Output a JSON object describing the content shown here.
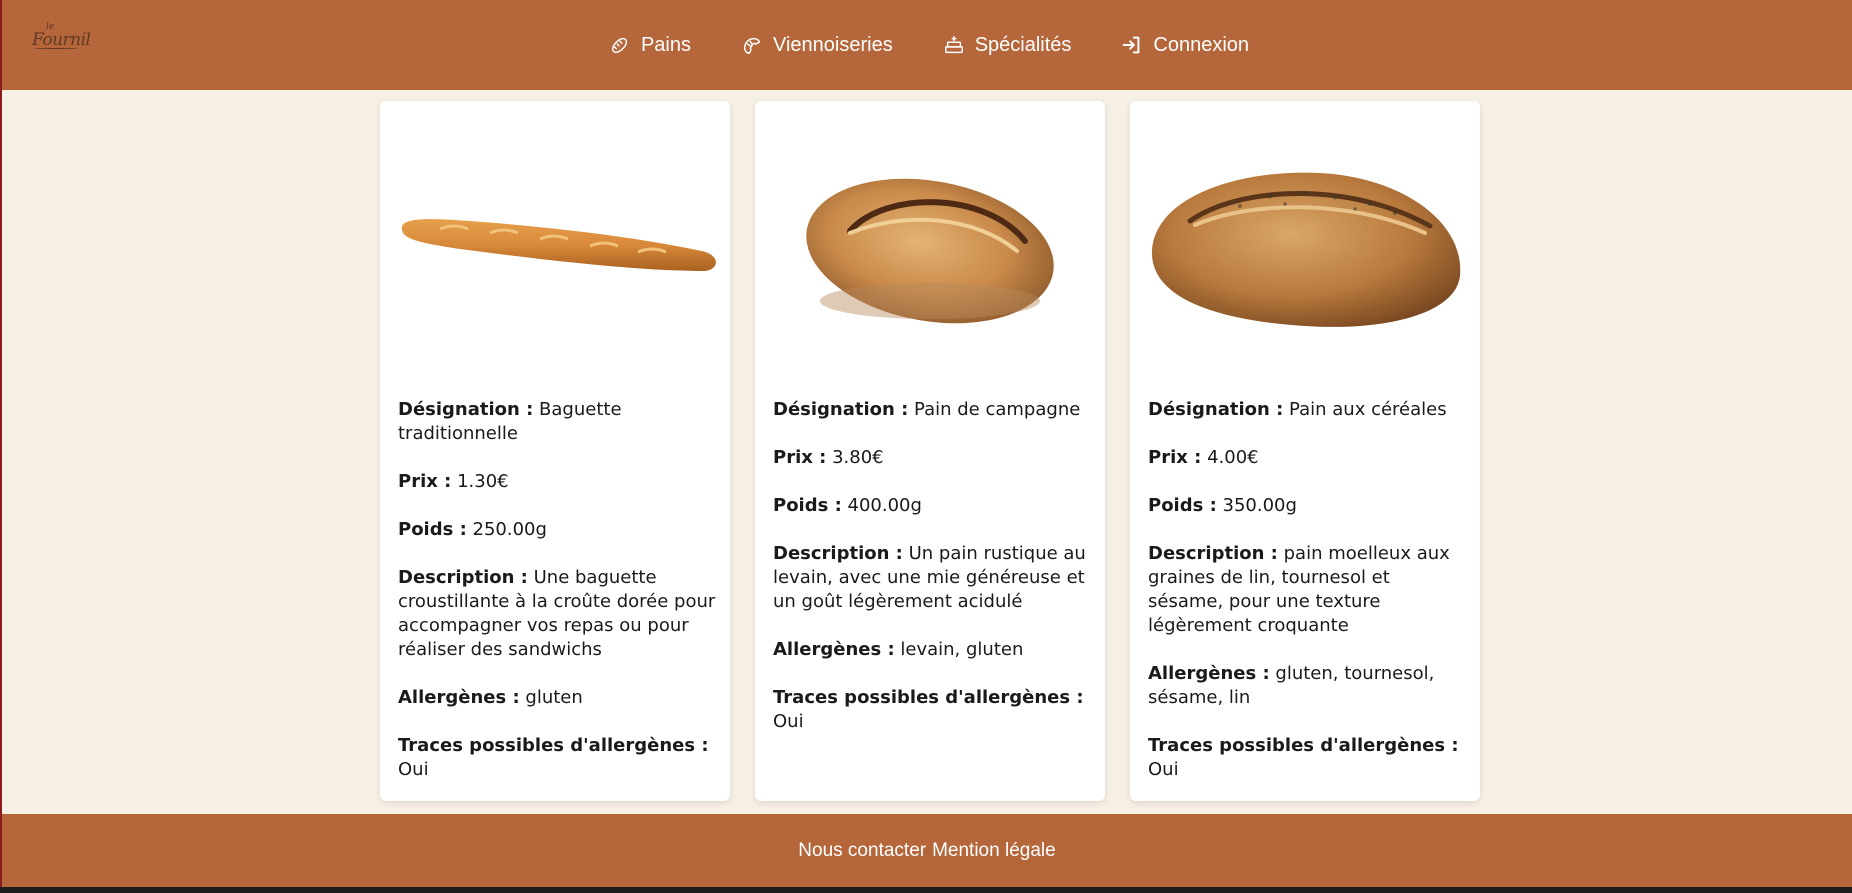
{
  "brand": {
    "logo_alt": "Le Fournil"
  },
  "nav": {
    "items": [
      {
        "label": "Pains",
        "icon": "bread-icon"
      },
      {
        "label": "Viennoiseries",
        "icon": "croissant-icon"
      },
      {
        "label": "Spécialités",
        "icon": "cake-icon"
      },
      {
        "label": "Connexion",
        "icon": "login-icon"
      }
    ]
  },
  "labels": {
    "designation": "Désignation :",
    "prix": "Prix :",
    "poids": "Poids :",
    "description": "Description :",
    "allergenes": "Allergènes :",
    "traces": "Traces possibles d'allergènes :"
  },
  "products": [
    {
      "designation": "Baguette traditionnelle",
      "prix": "1.30€",
      "poids": "250.00g",
      "description": "Une baguette croustillante à la croûte dorée pour accompagner vos repas ou pour réaliser des sandwichs",
      "allergenes": "gluten",
      "traces": "Oui"
    },
    {
      "designation": "Pain de campagne",
      "prix": "3.80€",
      "poids": "400.00g",
      "description": "Un pain rustique au levain, avec une mie généreuse et un goût légèrement acidulé",
      "allergenes": "levain, gluten",
      "traces": "Oui"
    },
    {
      "designation": "Pain aux céréales",
      "prix": "4.00€",
      "poids": "350.00g",
      "description": "pain moelleux aux graines de lin, tournesol et sésame, pour une texture légèrement croquante",
      "allergenes": "gluten, tournesol, sésame, lin",
      "traces": "Oui"
    }
  ],
  "footer": {
    "contact": "Nous contacter",
    "legal": "Mention légale"
  },
  "colors": {
    "primary": "#b5673b",
    "background": "#f6efe4",
    "card": "#ffffff"
  }
}
